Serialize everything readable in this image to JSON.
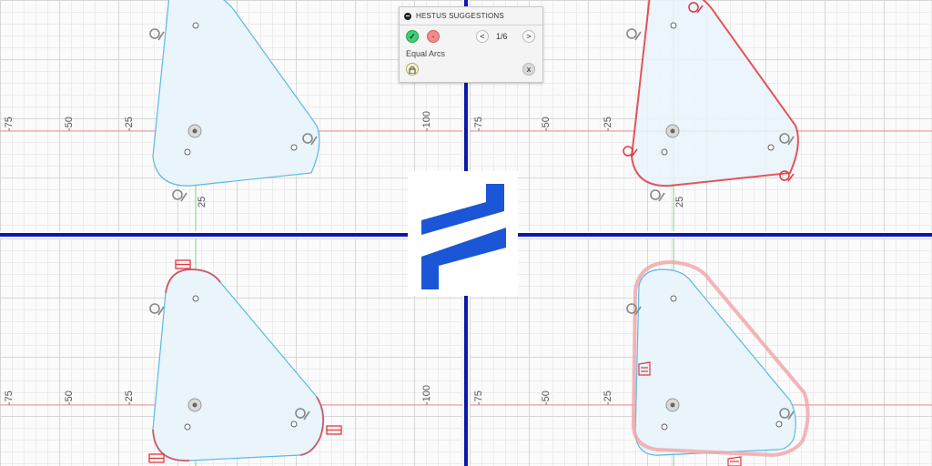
{
  "panel": {
    "title": "HESTUS SUGGESTIONS",
    "accept_icon": "checkmark-icon",
    "accept_glyph": "✓",
    "reject_glyph": "-",
    "prev_glyph": "<",
    "next_glyph": ">",
    "counter": "1/6",
    "suggestion_name": "Equal Arcs",
    "lock_icon": "lock-icon",
    "close_glyph": "x"
  },
  "tick_labels": [
    "-75",
    "-50",
    "-25",
    "-100"
  ],
  "vertical_tick_label": "25",
  "colors": {
    "divider": "#0a1aa8",
    "profile_stroke": "#5cb8e6",
    "profile_fill": "#e9f5fb",
    "constraint_red": "#e0383f",
    "suggested_arc": "#f2a3a8",
    "axis_red": "#f08c8c",
    "axis_green": "#7fd27f",
    "logo_blue": "#1a56d6"
  },
  "logo": {
    "name": "Hestus logo"
  }
}
